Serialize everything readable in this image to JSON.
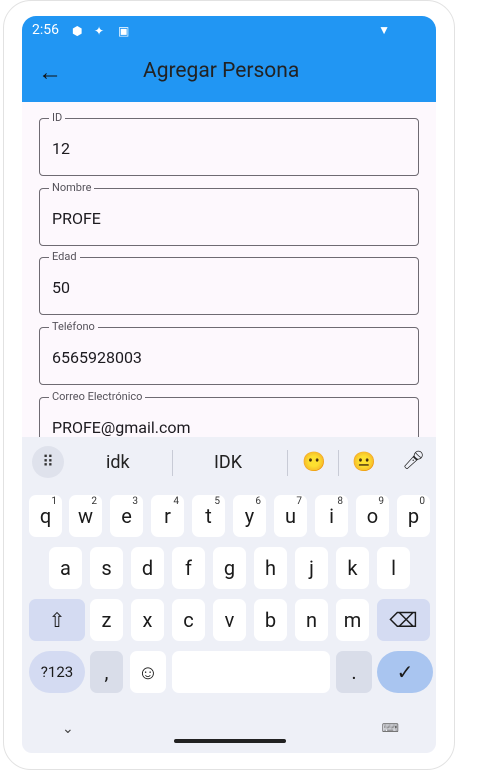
{
  "status_bar": {
    "time": "2:56",
    "icons": [
      "play-protect-icon",
      "data-saver-icon",
      "sim-icon",
      "wifi-icon"
    ]
  },
  "app_bar": {
    "title": "Agregar Persona",
    "back_icon": "arrow-back-icon"
  },
  "form": {
    "fields": [
      {
        "label": "ID",
        "value": "12"
      },
      {
        "label": "Nombre",
        "value": "PROFE"
      },
      {
        "label": "Edad",
        "value": "50"
      },
      {
        "label": "Teléfono",
        "value": "6565928003"
      },
      {
        "label": "Correo Electrónico",
        "value": "PROFE@gmail.com"
      }
    ]
  },
  "keyboard": {
    "suggestions": [
      "idk",
      "IDK"
    ],
    "emoji_suggestions": [
      "😶",
      "😐"
    ],
    "row1": [
      "q",
      "w",
      "e",
      "r",
      "t",
      "y",
      "u",
      "i",
      "o",
      "p"
    ],
    "row1_numbers": [
      "1",
      "2",
      "3",
      "4",
      "5",
      "6",
      "7",
      "8",
      "9",
      "0"
    ],
    "row2": [
      "a",
      "s",
      "d",
      "f",
      "g",
      "h",
      "j",
      "k",
      "l"
    ],
    "row3": [
      "z",
      "x",
      "c",
      "v",
      "b",
      "n",
      "m"
    ],
    "symbols_label": "?123",
    "comma": ",",
    "period": ".",
    "shift_icon": "⇧",
    "backspace_icon": "⌫",
    "enter_icon": "✓",
    "emoji_icon": "☺",
    "grid_icon": "⠿",
    "mic_icon": "🎤",
    "collapse_icon": "⌄",
    "keyboard_switch_icon": "⌨"
  },
  "colors": {
    "app_bar": "#2196f3",
    "screen_bg": "#fdf8fd",
    "keyboard_bg": "#eef0f7",
    "enter_key": "#a9c5f0"
  }
}
